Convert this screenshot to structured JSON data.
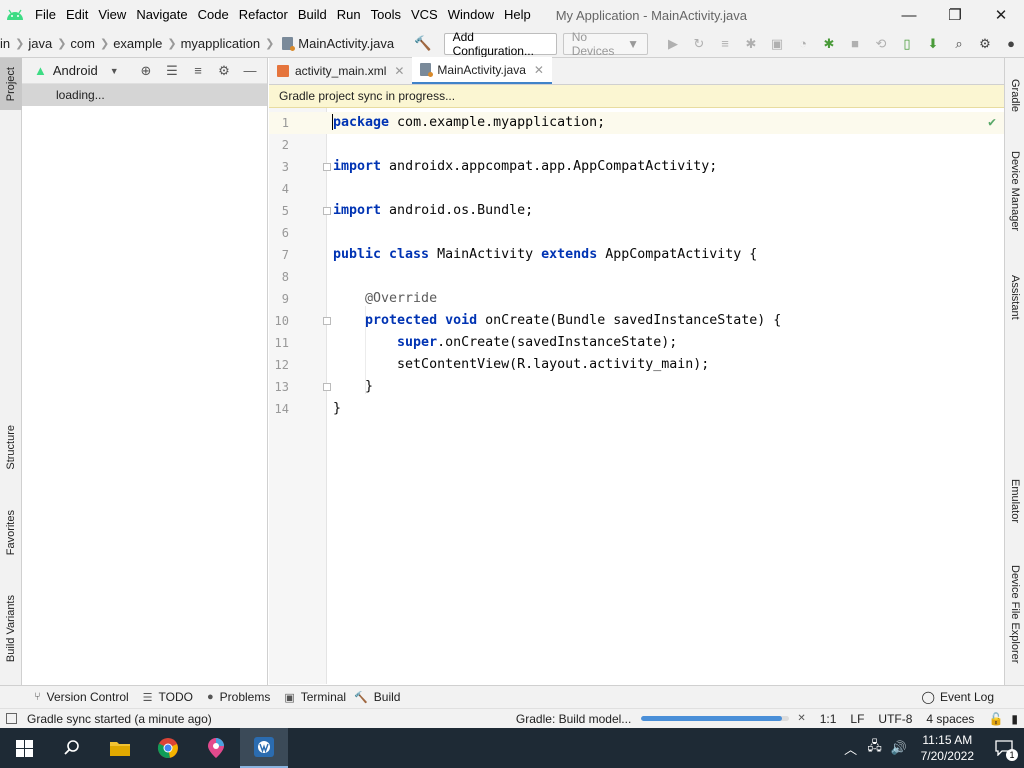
{
  "window": {
    "title": "My Application - MainActivity.java",
    "menu": [
      "File",
      "Edit",
      "View",
      "Navigate",
      "Code",
      "Refactor",
      "Build",
      "Run",
      "Tools",
      "VCS",
      "Window",
      "Help"
    ],
    "minimize": "—",
    "maximize": "❐",
    "close": "✕"
  },
  "breadcrumbs": [
    "in",
    "java",
    "com",
    "example",
    "myapplication",
    "MainActivity.java"
  ],
  "toolbar": {
    "config_label": "Add Configuration...",
    "devices_label": "No Devices"
  },
  "left_tabs": {
    "project": "Project",
    "structure": "Structure",
    "favorites": "Favorites",
    "build_variants": "Build Variants"
  },
  "project_panel": {
    "view_mode": "Android",
    "loading": "loading..."
  },
  "editor": {
    "tabs": [
      {
        "label": "activity_main.xml",
        "type": "xml"
      },
      {
        "label": "MainActivity.java",
        "type": "java",
        "active": true
      }
    ],
    "banner": "Gradle project sync in progress...",
    "line_numbers": [
      "1",
      "2",
      "3",
      "4",
      "5",
      "6",
      "7",
      "8",
      "9",
      "10",
      "11",
      "12",
      "13",
      "14"
    ],
    "code": {
      "l1_kw": "package",
      "l1_rest": " com.example.myapplication;",
      "l3_kw": "import",
      "l3_rest": " androidx.appcompat.app.AppCompatActivity;",
      "l5_kw": "import",
      "l5_rest": " android.os.Bundle;",
      "l7_kw1": "public class",
      "l7_mid": " MainActivity ",
      "l7_kw2": "extends",
      "l7_rest": " AppCompatActivity {",
      "l9_ann": "    @Override",
      "l10_kw": "    protected void",
      "l10_rest": " onCreate(Bundle savedInstanceState) {",
      "l11_kw": "        super",
      "l11_rest": ".onCreate(savedInstanceState);",
      "l12": "        setContentView(R.layout.activity_main);",
      "l13": "    }",
      "l14": "}"
    }
  },
  "right_tabs": {
    "gradle": "Gradle",
    "device_manager": "Device Manager",
    "assistant": "Assistant",
    "emulator": "Emulator",
    "device_file_explorer": "Device File Explorer"
  },
  "bottom_tools": [
    "Version Control",
    "TODO",
    "Problems",
    "Terminal",
    "Build"
  ],
  "event_log": "Event Log",
  "status": {
    "message": "Gradle sync started (a minute ago)",
    "task": "Gradle: Build model...",
    "progress_fraction": 0.95,
    "position": "1:1",
    "line_sep": "LF",
    "encoding": "UTF-8",
    "indent": "4 spaces"
  },
  "taskbar": {
    "time": "11:15 AM",
    "date": "7/20/2022",
    "notifications": "1"
  }
}
